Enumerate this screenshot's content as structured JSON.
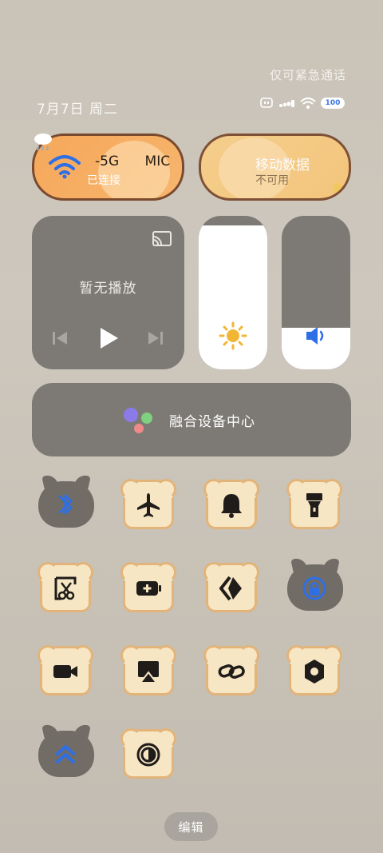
{
  "status": {
    "emergency_only": "仅可紧急通话",
    "date": "7月7日 周二",
    "battery": "100"
  },
  "wifi_pill": {
    "title": "-5G      MIC",
    "subtitle": "已连接"
  },
  "data_pill": {
    "title": "移动数据",
    "subtitle": "不可用"
  },
  "media": {
    "title": "暂无播放"
  },
  "sliders": {
    "brightness_level": 0.94,
    "volume_level": 0.27
  },
  "device_center": {
    "label": "融合设备中心"
  },
  "tiles": [
    {
      "name": "bluetooth",
      "style": "cat",
      "active": true
    },
    {
      "name": "airplane-mode",
      "style": "toast",
      "active": false
    },
    {
      "name": "do-not-disturb",
      "style": "toast",
      "active": false
    },
    {
      "name": "flashlight",
      "style": "toast",
      "active": false
    },
    {
      "name": "screenshot",
      "style": "toast",
      "active": false
    },
    {
      "name": "battery-saver",
      "style": "toast",
      "active": false
    },
    {
      "name": "nfc-share",
      "style": "toast",
      "active": false
    },
    {
      "name": "rotation-lock",
      "style": "cat",
      "active": true
    },
    {
      "name": "screen-record",
      "style": "toast",
      "active": false
    },
    {
      "name": "screen-cast",
      "style": "toast",
      "active": false
    },
    {
      "name": "link-share",
      "style": "toast",
      "active": false
    },
    {
      "name": "settings",
      "style": "toast",
      "active": false
    },
    {
      "name": "scroll-up",
      "style": "cat",
      "active": true
    },
    {
      "name": "eye-comfort",
      "style": "toast",
      "active": false
    }
  ],
  "edit_button": {
    "label": "编辑"
  },
  "colors": {
    "accent": "#2f6fe6",
    "panel": "#7d7a75",
    "toast": "#f7e6c4",
    "toast_border": "#e3b47a"
  }
}
